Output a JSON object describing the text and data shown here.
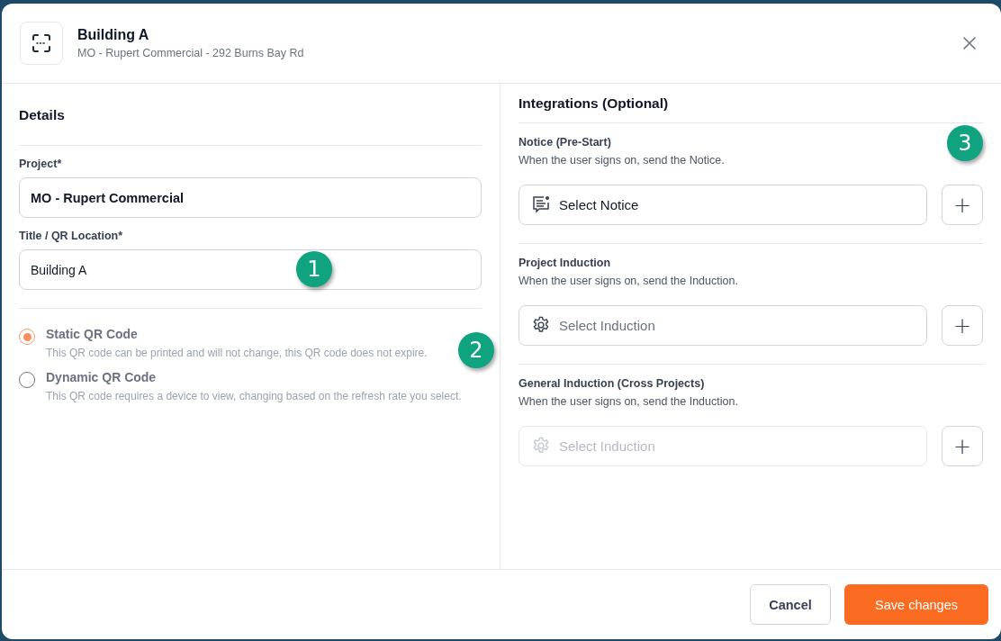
{
  "header": {
    "title": "Building A",
    "subtitle": "MO - Rupert Commercial - 292 Burns Bay Rd"
  },
  "details": {
    "heading": "Details",
    "fields": [
      {
        "label": "Project*",
        "value": "MO - Rupert Commercial",
        "bold": true
      },
      {
        "label": "Title / QR Location*",
        "value": "Building A",
        "bold": false
      }
    ],
    "qr_types": [
      {
        "label": "Static QR Code",
        "description": "This QR code can be printed and will not change, this QR code does not expire.",
        "selected": true
      },
      {
        "label": "Dynamic QR Code",
        "description": "This QR code requires a device to view, changing based on the refresh rate you select.",
        "selected": false
      }
    ]
  },
  "integrations": {
    "heading": "Integrations (Optional)",
    "sections": [
      {
        "title": "Notice (Pre-Start)",
        "description": "When the user signs on, send the Notice.",
        "kind": "notice",
        "value": "Select Notice",
        "disabled": false
      },
      {
        "title": "Project Induction",
        "description": "When the user signs on, send the Induction.",
        "kind": "induction",
        "placeholder": "Select Induction",
        "disabled": false
      },
      {
        "title": "General Induction (Cross Projects)",
        "description": "When the user signs on, send the Induction.",
        "kind": "induction",
        "placeholder": "Select Induction",
        "disabled": true
      }
    ],
    "add_button": "+"
  },
  "footer": {
    "buttons": [
      {
        "label": "Cancel",
        "kind": "secondary"
      },
      {
        "label": "Save changes",
        "kind": "primary"
      }
    ]
  },
  "annotations": [
    "1",
    "2",
    "3"
  ]
}
